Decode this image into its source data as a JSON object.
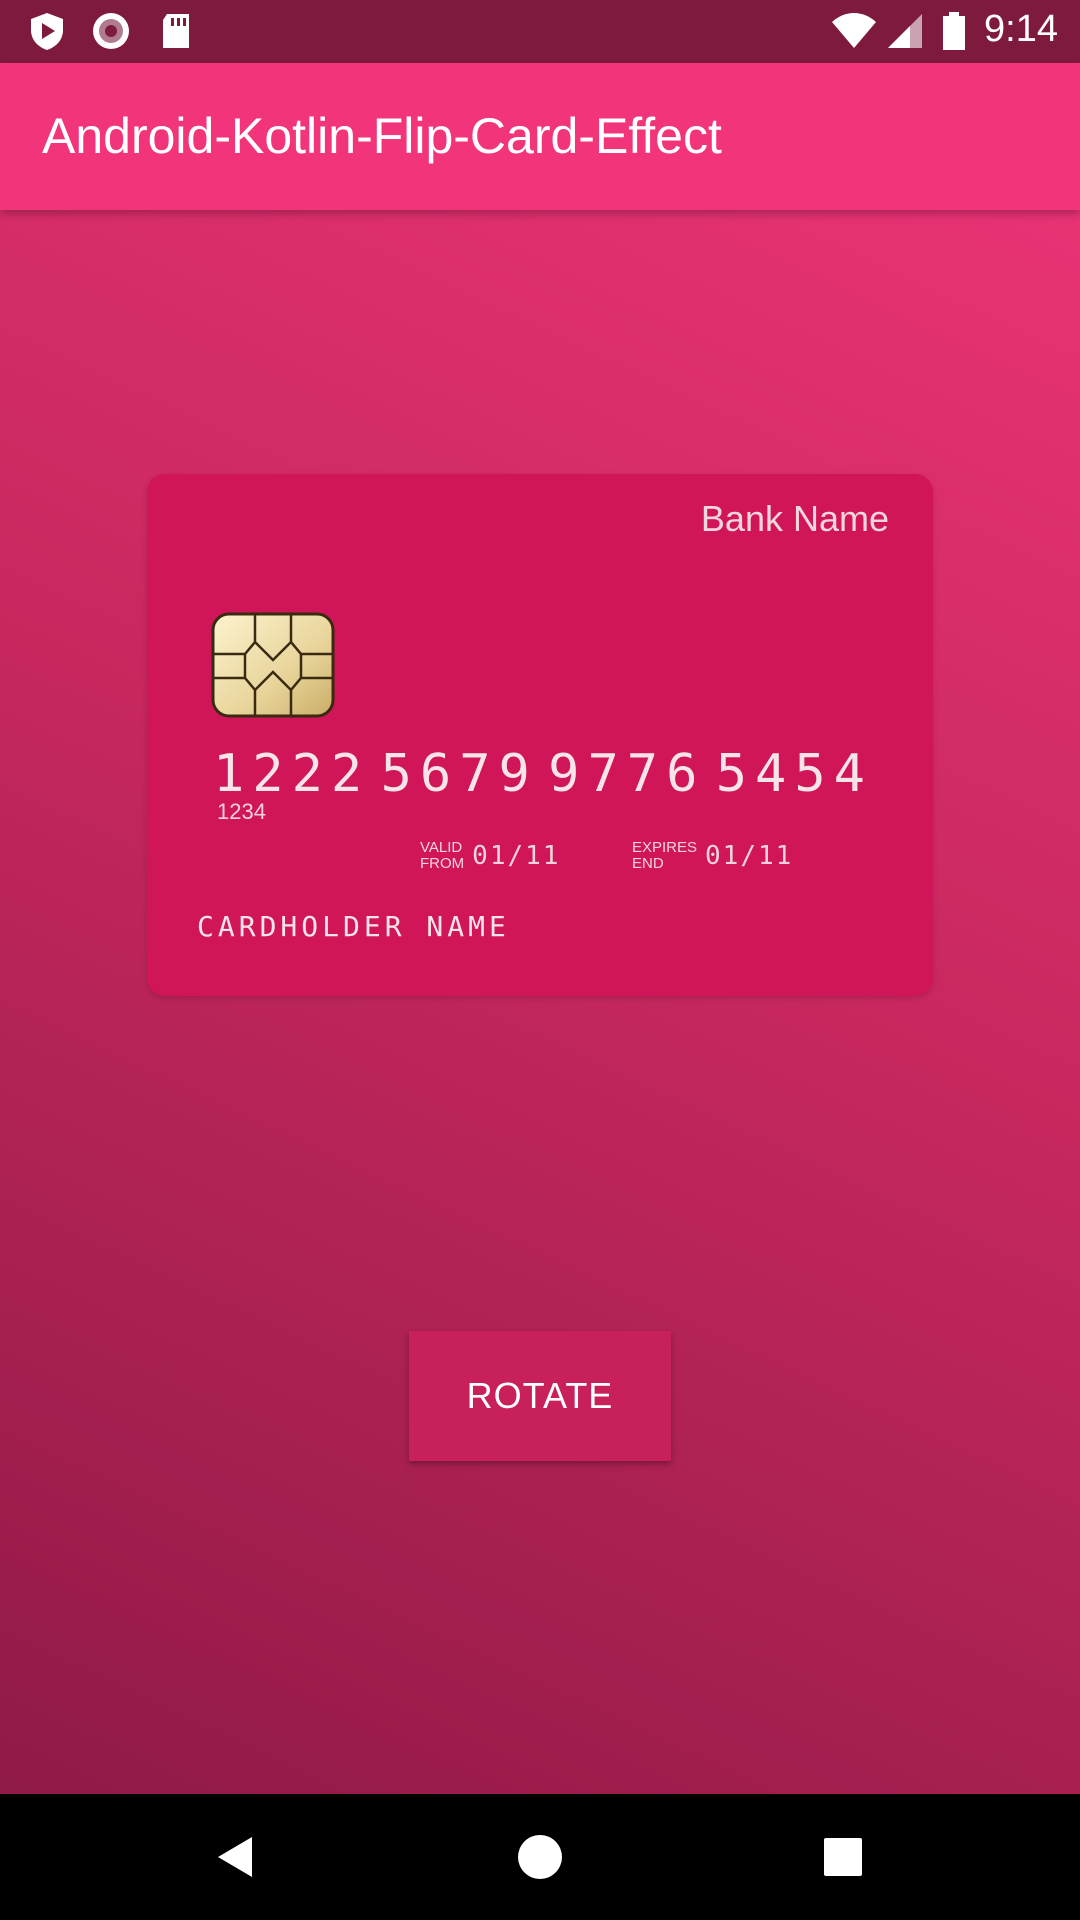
{
  "status_bar": {
    "time": "9:14",
    "icons": [
      "play-protect-icon",
      "record-icon",
      "sd-card-icon",
      "wifi-icon",
      "cell-signal-icon",
      "battery-icon"
    ]
  },
  "app_bar": {
    "title": "Android-Kotlin-Flip-Card-Effect"
  },
  "card": {
    "bank_name": "Bank Name",
    "number_groups": [
      "1222",
      "5679",
      "9776",
      "5454"
    ],
    "sub_number": "1234",
    "valid_from_label": [
      "VALID",
      "FROM"
    ],
    "valid_from": "01/11",
    "expires_label": [
      "EXPIRES",
      "END"
    ],
    "expires": "01/11",
    "cardholder": "CARDHOLDER NAME"
  },
  "actions": {
    "rotate_label": "ROTATE"
  },
  "nav_bar": {
    "icons": [
      "back-icon",
      "home-icon",
      "recents-icon"
    ]
  },
  "colors": {
    "status_bar": "#7f1a3f",
    "app_bar": "#f2357b",
    "card": "#d01558",
    "button": "#c8205b"
  }
}
